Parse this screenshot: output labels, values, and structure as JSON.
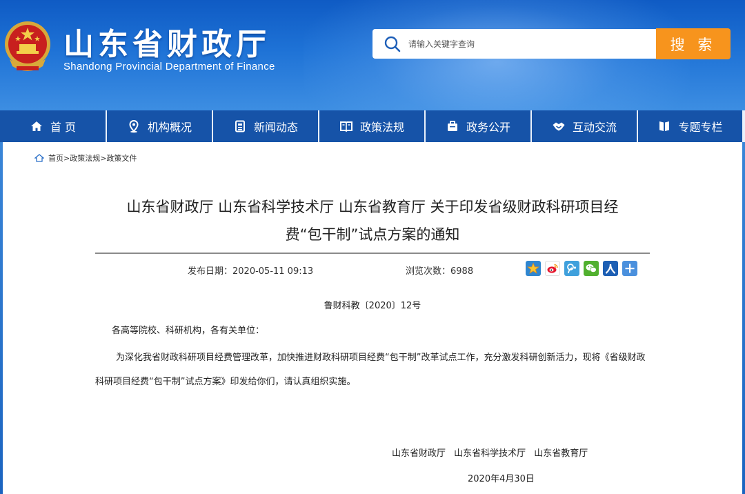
{
  "header": {
    "title": "山东省财政厅",
    "subtitle": "Shandong Provincial Department of Finance",
    "search_placeholder": "请输入关键字查询",
    "search_button": "搜 索"
  },
  "nav": {
    "items": [
      {
        "label": "首 页",
        "icon": "home-icon"
      },
      {
        "label": "机构概况",
        "icon": "location-pin-icon"
      },
      {
        "label": "新闻动态",
        "icon": "news-icon"
      },
      {
        "label": "政策法规",
        "icon": "book-icon"
      },
      {
        "label": "政务公开",
        "icon": "briefcase-icon"
      },
      {
        "label": "互动交流",
        "icon": "handshake-icon"
      },
      {
        "label": "专题专栏",
        "icon": "bookmark-icon"
      }
    ]
  },
  "breadcrumb": {
    "items": [
      "首页>",
      "政策法规>",
      "政策文件"
    ]
  },
  "article": {
    "title_line1": "山东省财政厅 山东省科学技术厅 山东省教育厅 关于印发省级财政科研项目经",
    "title_line2": "费“包干制”试点方案的通知",
    "publish_date": "发布日期：2020-05-11 09:13",
    "view_count": "浏览次数：6988",
    "doc_number": "鲁财科教〔2020〕12号",
    "salutation": "各高等院校、科研机构，各有关单位：",
    "body": "为深化我省财政科研项目经费管理改革，加快推进财政科研项目经费“包干制”改革试点工作，充分激发科研创新活力，现将《省级财政科研项目经费“包干制”试点方案》印发给你们，请认真组织实施。",
    "signers": "山东省财政厅  山东省科学技术厅  山东省教育厅",
    "sign_date": "2020年4月30日"
  },
  "share": {
    "icons": [
      "qzone-star-icon",
      "weibo-icon",
      "tencent-weibo-icon",
      "wechat-icon",
      "renren-icon",
      "more-share-icon"
    ]
  },
  "colors": {
    "header_blue": "#1e72d6",
    "nav_blue": "#1653a8",
    "search_orange": "#f7941d"
  }
}
